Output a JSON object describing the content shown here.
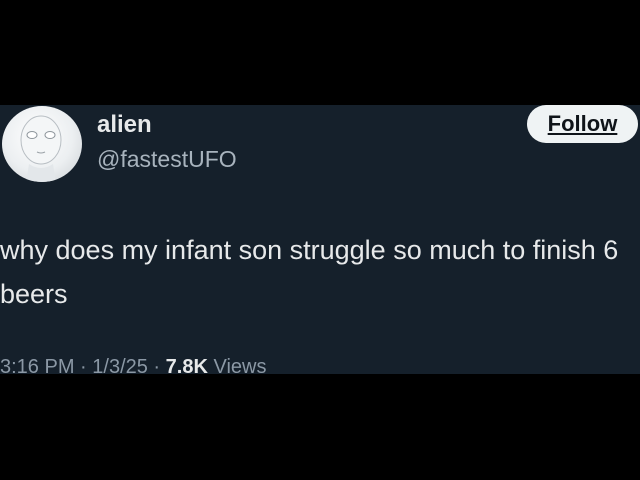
{
  "author": {
    "display_name": "alien",
    "handle": "@fastestUFO",
    "avatar_icon": "alien-avatar-icon"
  },
  "follow_label": "Follow",
  "tweet": {
    "text": "why does my infant son struggle so much to finish 6 beers"
  },
  "meta": {
    "time": "3:16 PM",
    "date": "1/3/25",
    "separator": " · ",
    "views_count": "7.8K",
    "views_label": "Views"
  },
  "colors": {
    "background": "#000000",
    "card": "#15202b",
    "primary_text": "#e7e9ea",
    "secondary_text": "#8b98a5",
    "follow_bg": "#eff3f4"
  }
}
